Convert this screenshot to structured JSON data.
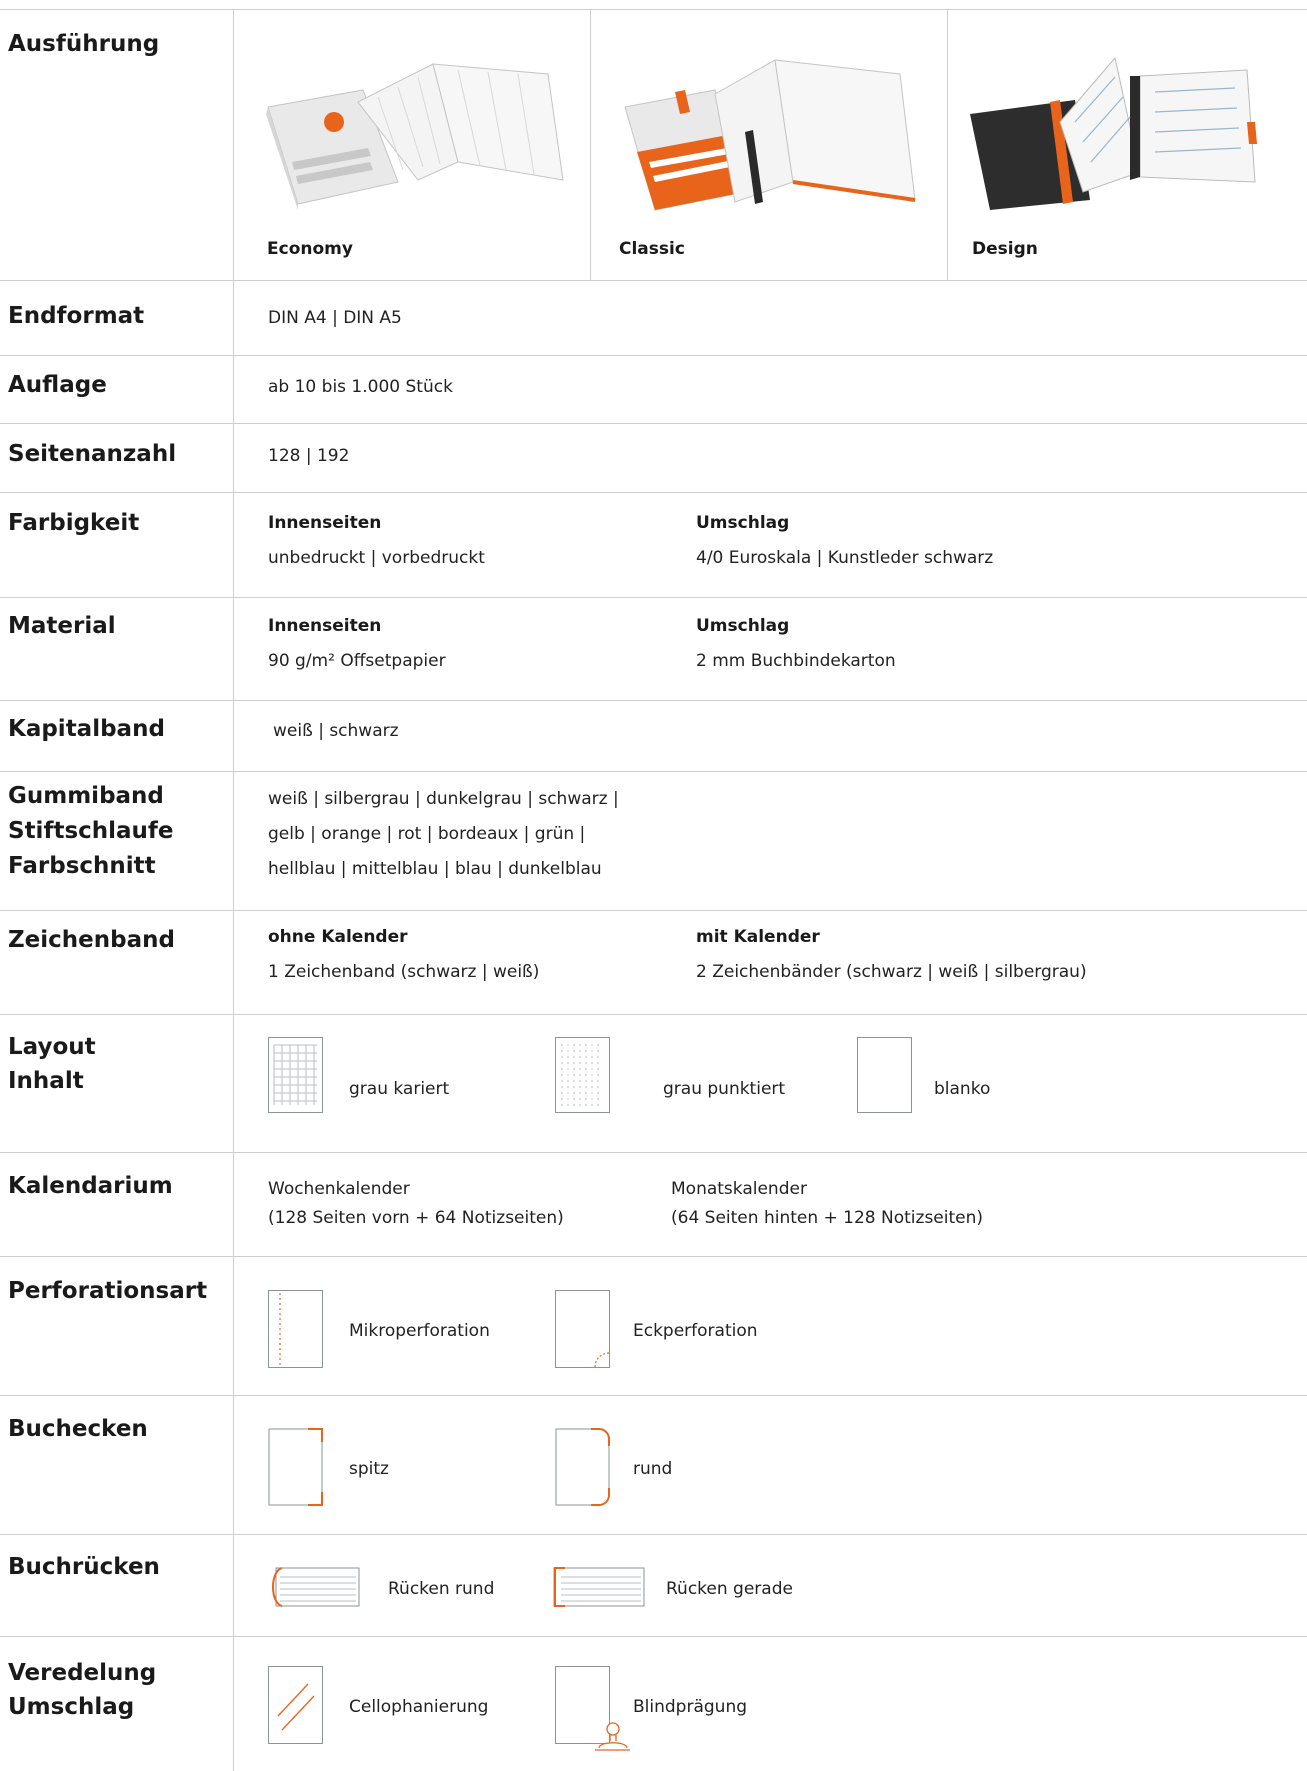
{
  "rows": {
    "ausfuehrung": {
      "label": "Ausführung",
      "variants": [
        "Economy",
        "Classic",
        "Design"
      ]
    },
    "endformat": {
      "label": "Endformat",
      "value": "DIN A4 | DIN A5"
    },
    "auflage": {
      "label": "Auflage",
      "value": "ab 10 bis 1.000 Stück"
    },
    "seitenanzahl": {
      "label": "Seitenanzahl",
      "value": "128 | 192"
    },
    "farbigkeit": {
      "label": "Farbigkeit",
      "col1_head": "Innenseiten",
      "col1_value": "unbedruckt | vorbedruckt",
      "col2_head": "Umschlag",
      "col2_value": "4/0 Euroskala | Kunstleder schwarz"
    },
    "material": {
      "label": "Material",
      "col1_head": "Innenseiten",
      "col1_value": "90 g/m² Offsetpapier",
      "col2_head": "Umschlag",
      "col2_value": "2 mm Buchbindekarton"
    },
    "kapitalband": {
      "label": "Kapitalband",
      "value": "weiß | schwarz"
    },
    "gummiband": {
      "label_lines": [
        "Gummiband",
        "Stiftschlaufe",
        "Farbschnitt"
      ],
      "value_lines": [
        "weiß | silbergrau | dunkelgrau | schwarz |",
        "gelb | orange | rot | bordeaux | grün |",
        "hellblau | mittelblau | blau | dunkelblau"
      ]
    },
    "zeichenband": {
      "label": "Zeichenband",
      "col1_head": "ohne Kalender",
      "col1_value": "1 Zeichenband (schwarz | weiß)",
      "col2_head": "mit Kalender",
      "col2_value": "2 Zeichenbänder (schwarz | weiß | silbergrau)"
    },
    "layout": {
      "label_lines": [
        "Layout",
        "Inhalt"
      ],
      "options": [
        "grau kariert",
        "grau punktiert",
        "blanko"
      ]
    },
    "kalendarium": {
      "label": "Kalendarium",
      "col1_line1": "Wochenkalender",
      "col1_line2": "(128 Seiten vorn + 64 Notizseiten)",
      "col2_line1": "Monatskalender",
      "col2_line2": "(64 Seiten hinten + 128 Notizseiten)"
    },
    "perforation": {
      "label": "Perforationsart",
      "options": [
        "Mikroperforation",
        "Eckperforation"
      ]
    },
    "buchecken": {
      "label": "Buchecken",
      "options": [
        "spitz",
        "rund"
      ]
    },
    "buchruecken": {
      "label": "Buchrücken",
      "options": [
        "Rücken rund",
        "Rücken gerade"
      ]
    },
    "veredelung": {
      "label_lines": [
        "Veredelung",
        "Umschlag"
      ],
      "options": [
        "Cellophanierung",
        "Blindprägung"
      ]
    }
  },
  "colors": {
    "accent": "#e8641b",
    "line": "#cfcfcf",
    "icon_stroke": "#8a949a"
  }
}
